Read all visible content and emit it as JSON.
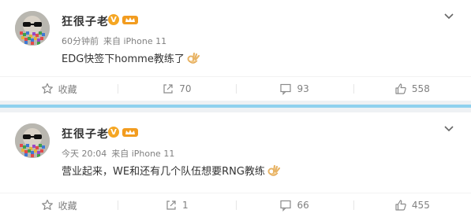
{
  "posts": [
    {
      "author": "狂很子老",
      "verified_badge": "V",
      "time": "60分钟前",
      "source": "来自 iPhone 11",
      "text": "EDG快签下homme教练了",
      "emoji": "ok-hand-icon",
      "actions": {
        "favorite": "收藏",
        "repost": "70",
        "comment": "93",
        "like": "558"
      }
    },
    {
      "author": "狂很子老",
      "verified_badge": "V",
      "time": "今天 20:04",
      "source": "来自 iPhone 11",
      "text": "营业起来，WE和还有几个队伍想要RNG教练",
      "emoji": "ok-hand-icon",
      "actions": {
        "favorite": "收藏",
        "repost": "1",
        "comment": "66",
        "like": "455"
      }
    }
  ],
  "colors": {
    "accent": "#f5a623",
    "separator": "#eef1f4",
    "strip": "#8fd1ee",
    "meta": "#808080"
  }
}
